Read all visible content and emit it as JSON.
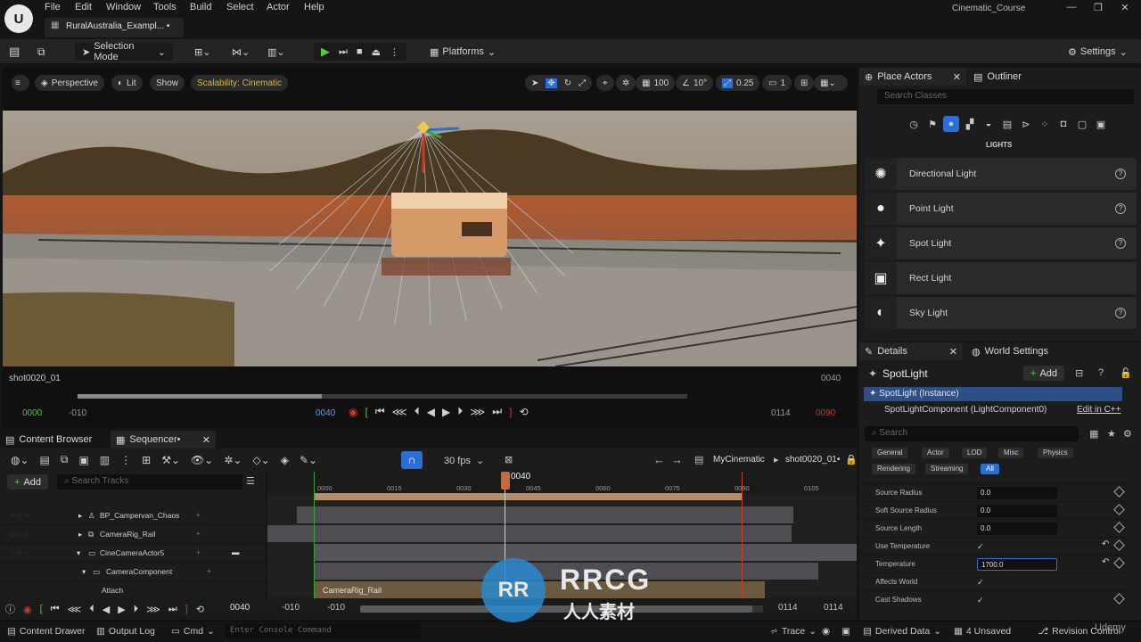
{
  "menubar": {
    "logo": "U",
    "menus": [
      "File",
      "Edit",
      "Window",
      "Tools",
      "Build",
      "Select",
      "Actor",
      "Help"
    ],
    "doc_tab": "RuralAustralia_Exampl... •",
    "project": "Cinematic_Course"
  },
  "toolbar": {
    "selection_mode": "Selection Mode",
    "platforms": "Platforms",
    "settings": "Settings"
  },
  "viewport": {
    "perspective": "Perspective",
    "lit": "Lit",
    "show": "Show",
    "scalability": "Scalability: Cinematic",
    "grid": "100",
    "rot": "10°",
    "scale": "0.25",
    "cams": "1"
  },
  "scrub": {
    "shot": "shot0020_01",
    "end_frame": "0040",
    "start": "0000",
    "minus": "-010",
    "current": "0040",
    "r1": "0114",
    "r2": "0090",
    "progress": 0.4
  },
  "place_actors": {
    "tab": "Place Actors",
    "outliner": "Outliner",
    "search": "Search Classes",
    "category": "LIGHTS",
    "items": [
      {
        "label": "Directional Light",
        "icon": "directional-light-icon",
        "glyph": "✺"
      },
      {
        "label": "Point Light",
        "icon": "point-light-icon",
        "glyph": "●"
      },
      {
        "label": "Spot Light",
        "icon": "spot-light-icon",
        "glyph": "✦"
      },
      {
        "label": "Rect Light",
        "icon": "rect-light-icon",
        "glyph": "▣"
      },
      {
        "label": "Sky Light",
        "icon": "sky-light-icon",
        "glyph": "◐"
      }
    ]
  },
  "details": {
    "tab": "Details",
    "world": "World Settings",
    "actor": "SpotLight",
    "add": "Add",
    "instance": "SpotLight (Instance)",
    "component": "SpotLightComponent (LightComponent0)",
    "edit_cpp": "Edit in C++",
    "search": "Search",
    "filters_row1": [
      "General",
      "Actor",
      "LOD",
      "Misc",
      "Physics"
    ],
    "filters_row2": [
      "Rendering",
      "Streaming",
      "All"
    ],
    "props": [
      {
        "label": "Source Radius",
        "value": "0.0"
      },
      {
        "label": "Soft Source Radius",
        "value": "0.0"
      },
      {
        "label": "Source Length",
        "value": "0.0"
      },
      {
        "label": "Use Temperature",
        "value": "✓"
      },
      {
        "label": "Temperature",
        "value": "1700.0"
      },
      {
        "label": "Affects World",
        "value": "✓"
      },
      {
        "label": "Cast Shadows",
        "value": "✓"
      }
    ]
  },
  "sequencer": {
    "content_browser": "Content Browser",
    "tab": "Sequencer•",
    "fps": "30 fps",
    "seq_name": "MyCinematic",
    "shot": "shot0020_01•",
    "add": "Add",
    "search": "Search Tracks",
    "playhead": "0040",
    "ticks": [
      "0000",
      "0015",
      "0030",
      "0045",
      "0060",
      "0075",
      "0090",
      "0105"
    ],
    "tracks": [
      "BP_Campervan_Chaos",
      "CameraRig_Rail",
      "CineCameraActor5",
      "CameraComponent",
      "Attach"
    ],
    "rail_label": "CameraRig_Rail",
    "bottom": {
      "current": "0040",
      "a": "-010",
      "b": "-010",
      "c": "0114",
      "d": "0114"
    }
  },
  "status": {
    "content_drawer": "Content Drawer",
    "output_log": "Output Log",
    "cmd": "Cmd",
    "console": "Enter Console Command",
    "trace": "Trace",
    "derived": "Derived Data",
    "unsaved": "4 Unsaved",
    "revision": "Revision Control"
  },
  "watermark": {
    "brand": "RRCG",
    "sub": "人人素材",
    "site": "Udemy"
  }
}
